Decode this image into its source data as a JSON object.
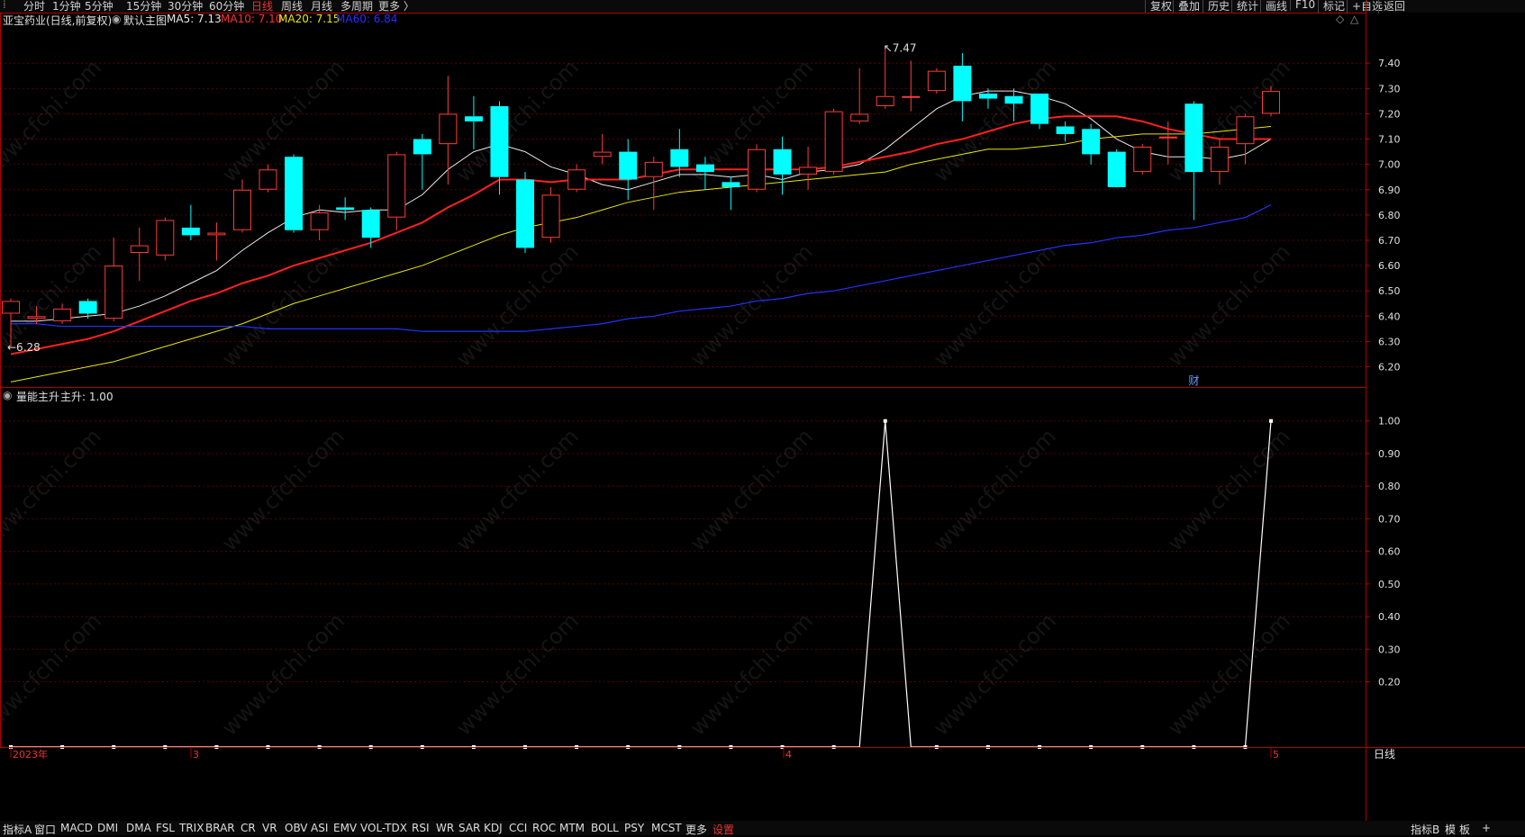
{
  "toolbar": {
    "left": [
      "分时",
      "1分钟",
      "5分钟",
      "15分钟",
      "30分钟",
      "60分钟",
      "日线",
      "周线",
      "月线",
      "多周期",
      "更多 〉"
    ],
    "active": "日线",
    "right": [
      "复权",
      "叠加",
      "历史",
      "统计",
      "画线",
      "F10",
      "标记",
      "+自选",
      "返回"
    ]
  },
  "main_info": {
    "stock": "亚宝药业(日线,前复权)",
    "template": "默认主图",
    "ma5": "MA5: 7.13",
    "ma10": "MA10: 7.10",
    "ma20": "MA20: 7.15",
    "ma60": "MA60: 6.84"
  },
  "indicator_info": {
    "name": "量能主升",
    "value": "主升: 1.00"
  },
  "watermark": "www.cfchi.com",
  "colors": {
    "up": "#ff3b3b",
    "down": "#00ffff",
    "ma5": "#e8e8e8",
    "ma10": "#ff2020",
    "ma20": "#e8e800",
    "ma60": "#2233ff",
    "grid": "#5a0000",
    "axis": "#b00000"
  },
  "chart_data": [
    {
      "type": "candlestick",
      "title": "亚宝药业(日线,前复权)",
      "ylim": [
        6.12,
        7.6
      ],
      "y_ticks": [
        "7.40",
        "7.30",
        "7.20",
        "7.10",
        "7.00",
        "6.90",
        "6.80",
        "6.70",
        "6.60",
        "6.50",
        "6.40",
        "6.30",
        "6.20"
      ],
      "x_labels": [
        "2023年",
        "3",
        "4",
        "5"
      ],
      "annotations": [
        "7.47",
        "6.28",
        "财"
      ],
      "candles": [
        {
          "o": 6.41,
          "c": 6.46,
          "h": 6.47,
          "l": 6.28
        },
        {
          "o": 6.39,
          "c": 6.4,
          "h": 6.44,
          "l": 6.37
        },
        {
          "o": 6.38,
          "c": 6.43,
          "h": 6.45,
          "l": 6.37
        },
        {
          "o": 6.46,
          "c": 6.41,
          "h": 6.47,
          "l": 6.39
        },
        {
          "o": 6.39,
          "c": 6.6,
          "h": 6.71,
          "l": 6.38
        },
        {
          "o": 6.65,
          "c": 6.68,
          "h": 6.75,
          "l": 6.54
        },
        {
          "o": 6.64,
          "c": 6.78,
          "h": 6.79,
          "l": 6.62
        },
        {
          "o": 6.75,
          "c": 6.72,
          "h": 6.84,
          "l": 6.7
        },
        {
          "o": 6.72,
          "c": 6.73,
          "h": 6.77,
          "l": 6.62
        },
        {
          "o": 6.74,
          "c": 6.9,
          "h": 6.94,
          "l": 6.73
        },
        {
          "o": 6.9,
          "c": 6.98,
          "h": 7.0,
          "l": 6.89
        },
        {
          "o": 7.03,
          "c": 6.74,
          "h": 7.04,
          "l": 6.73
        },
        {
          "o": 6.74,
          "c": 6.81,
          "h": 6.84,
          "l": 6.7
        },
        {
          "o": 6.83,
          "c": 6.82,
          "h": 6.87,
          "l": 6.78
        },
        {
          "o": 6.82,
          "c": 6.71,
          "h": 6.83,
          "l": 6.67
        },
        {
          "o": 6.79,
          "c": 7.04,
          "h": 7.05,
          "l": 6.74
        },
        {
          "o": 7.1,
          "c": 7.04,
          "h": 7.12,
          "l": 6.9
        },
        {
          "o": 7.08,
          "c": 7.2,
          "h": 7.35,
          "l": 6.92
        },
        {
          "o": 7.19,
          "c": 7.17,
          "h": 7.27,
          "l": 7.06
        },
        {
          "o": 7.23,
          "c": 6.95,
          "h": 7.25,
          "l": 6.88
        },
        {
          "o": 6.94,
          "c": 6.67,
          "h": 6.97,
          "l": 6.65
        },
        {
          "o": 6.71,
          "c": 6.88,
          "h": 6.91,
          "l": 6.69
        },
        {
          "o": 6.9,
          "c": 6.98,
          "h": 7.0,
          "l": 6.89
        },
        {
          "o": 7.03,
          "c": 7.05,
          "h": 7.12,
          "l": 7.0
        },
        {
          "o": 7.05,
          "c": 6.94,
          "h": 7.1,
          "l": 6.86
        },
        {
          "o": 6.95,
          "c": 7.01,
          "h": 7.03,
          "l": 6.82
        },
        {
          "o": 7.06,
          "c": 6.99,
          "h": 7.14,
          "l": 6.95
        },
        {
          "o": 7.0,
          "c": 6.97,
          "h": 7.03,
          "l": 6.9
        },
        {
          "o": 6.93,
          "c": 6.91,
          "h": 6.95,
          "l": 6.82
        },
        {
          "o": 6.9,
          "c": 7.06,
          "h": 7.08,
          "l": 6.89
        },
        {
          "o": 7.06,
          "c": 6.96,
          "h": 7.11,
          "l": 6.88
        },
        {
          "o": 6.96,
          "c": 6.99,
          "h": 7.07,
          "l": 6.9
        },
        {
          "o": 6.97,
          "c": 7.21,
          "h": 7.22,
          "l": 6.96
        },
        {
          "o": 7.17,
          "c": 7.2,
          "h": 7.38,
          "l": 7.16
        },
        {
          "o": 7.23,
          "c": 7.27,
          "h": 7.46,
          "l": 7.22
        },
        {
          "o": 7.27,
          "c": 7.27,
          "h": 7.41,
          "l": 7.21
        },
        {
          "o": 7.29,
          "c": 7.37,
          "h": 7.38,
          "l": 7.28
        },
        {
          "o": 7.39,
          "c": 7.25,
          "h": 7.44,
          "l": 7.17
        },
        {
          "o": 7.28,
          "c": 7.26,
          "h": 7.3,
          "l": 7.22
        },
        {
          "o": 7.27,
          "c": 7.24,
          "h": 7.3,
          "l": 7.17
        },
        {
          "o": 7.28,
          "c": 7.16,
          "h": 7.28,
          "l": 7.14
        },
        {
          "o": 7.15,
          "c": 7.12,
          "h": 7.17,
          "l": 7.09
        },
        {
          "o": 7.14,
          "c": 7.04,
          "h": 7.16,
          "l": 7.0
        },
        {
          "o": 7.05,
          "c": 6.91,
          "h": 7.06,
          "l": 6.91
        },
        {
          "o": 6.97,
          "c": 7.07,
          "h": 7.08,
          "l": 6.96
        },
        {
          "o": 7.11,
          "c": 7.11,
          "h": 7.17,
          "l": 7.0
        },
        {
          "o": 7.24,
          "c": 6.97,
          "h": 7.25,
          "l": 6.78
        },
        {
          "o": 6.97,
          "c": 7.07,
          "h": 7.1,
          "l": 6.92
        },
        {
          "o": 7.08,
          "c": 7.19,
          "h": 7.2,
          "l": 7.0
        },
        {
          "o": 7.2,
          "c": 7.29,
          "h": 7.31,
          "l": 7.19
        }
      ],
      "series": [
        {
          "name": "MA5",
          "values": [
            6.38,
            6.38,
            6.39,
            6.4,
            6.41,
            6.44,
            6.48,
            6.53,
            6.58,
            6.66,
            6.73,
            6.79,
            6.82,
            6.81,
            6.82,
            6.82,
            6.88,
            6.98,
            7.05,
            7.08,
            7.05,
            6.99,
            6.96,
            6.92,
            6.9,
            6.93,
            6.96,
            6.96,
            6.95,
            6.96,
            6.94,
            6.97,
            6.98,
            7.0,
            7.06,
            7.14,
            7.22,
            7.27,
            7.29,
            7.29,
            7.27,
            7.24,
            7.18,
            7.1,
            7.05,
            7.03,
            7.03,
            7.02,
            7.04,
            7.1
          ]
        },
        {
          "name": "MA10",
          "values": [
            6.25,
            6.27,
            6.29,
            6.31,
            6.34,
            6.38,
            6.42,
            6.46,
            6.49,
            6.53,
            6.56,
            6.6,
            6.63,
            6.66,
            6.69,
            6.73,
            6.77,
            6.83,
            6.88,
            6.94,
            6.94,
            6.93,
            6.94,
            6.94,
            6.94,
            6.96,
            6.98,
            6.98,
            6.98,
            6.98,
            6.98,
            6.98,
            6.99,
            7.01,
            7.03,
            7.05,
            7.08,
            7.1,
            7.13,
            7.16,
            7.18,
            7.19,
            7.19,
            7.19,
            7.17,
            7.14,
            7.12,
            7.1,
            7.1,
            7.1
          ]
        },
        {
          "name": "MA20",
          "values": [
            6.14,
            6.16,
            6.18,
            6.2,
            6.22,
            6.25,
            6.28,
            6.31,
            6.34,
            6.37,
            6.41,
            6.45,
            6.48,
            6.51,
            6.54,
            6.57,
            6.6,
            6.64,
            6.68,
            6.72,
            6.75,
            6.77,
            6.79,
            6.82,
            6.85,
            6.87,
            6.89,
            6.9,
            6.91,
            6.92,
            6.93,
            6.94,
            6.95,
            6.96,
            6.97,
            7.0,
            7.02,
            7.04,
            7.06,
            7.06,
            7.07,
            7.08,
            7.1,
            7.11,
            7.12,
            7.12,
            7.12,
            7.13,
            7.14,
            7.15
          ]
        },
        {
          "name": "MA60",
          "values": [
            6.37,
            6.37,
            6.36,
            6.36,
            6.36,
            6.36,
            6.36,
            6.36,
            6.36,
            6.36,
            6.35,
            6.35,
            6.35,
            6.35,
            6.35,
            6.35,
            6.34,
            6.34,
            6.34,
            6.34,
            6.34,
            6.35,
            6.36,
            6.37,
            6.39,
            6.4,
            6.42,
            6.43,
            6.44,
            6.46,
            6.47,
            6.49,
            6.5,
            6.52,
            6.54,
            6.56,
            6.58,
            6.6,
            6.62,
            6.64,
            6.66,
            6.68,
            6.69,
            6.71,
            6.72,
            6.74,
            6.75,
            6.77,
            6.79,
            6.84
          ]
        }
      ]
    },
    {
      "type": "line",
      "title": "量能主升",
      "ylim": [
        0,
        1.06
      ],
      "y_ticks": [
        "1.00",
        "0.90",
        "0.80",
        "0.70",
        "0.60",
        "0.50",
        "0.40",
        "0.30",
        "0.20"
      ],
      "series": [
        {
          "name": "主升",
          "values": [
            0,
            0,
            0,
            0,
            0,
            0,
            0,
            0,
            0,
            0,
            0,
            0,
            0,
            0,
            0,
            0,
            0,
            0,
            0,
            0,
            0,
            0,
            0,
            0,
            0,
            0,
            0,
            0,
            0,
            0,
            0,
            0,
            0,
            0,
            1,
            0,
            0,
            0,
            0,
            0,
            0,
            0,
            0,
            0,
            0,
            0,
            0,
            0,
            0,
            1
          ]
        }
      ]
    }
  ]
}
